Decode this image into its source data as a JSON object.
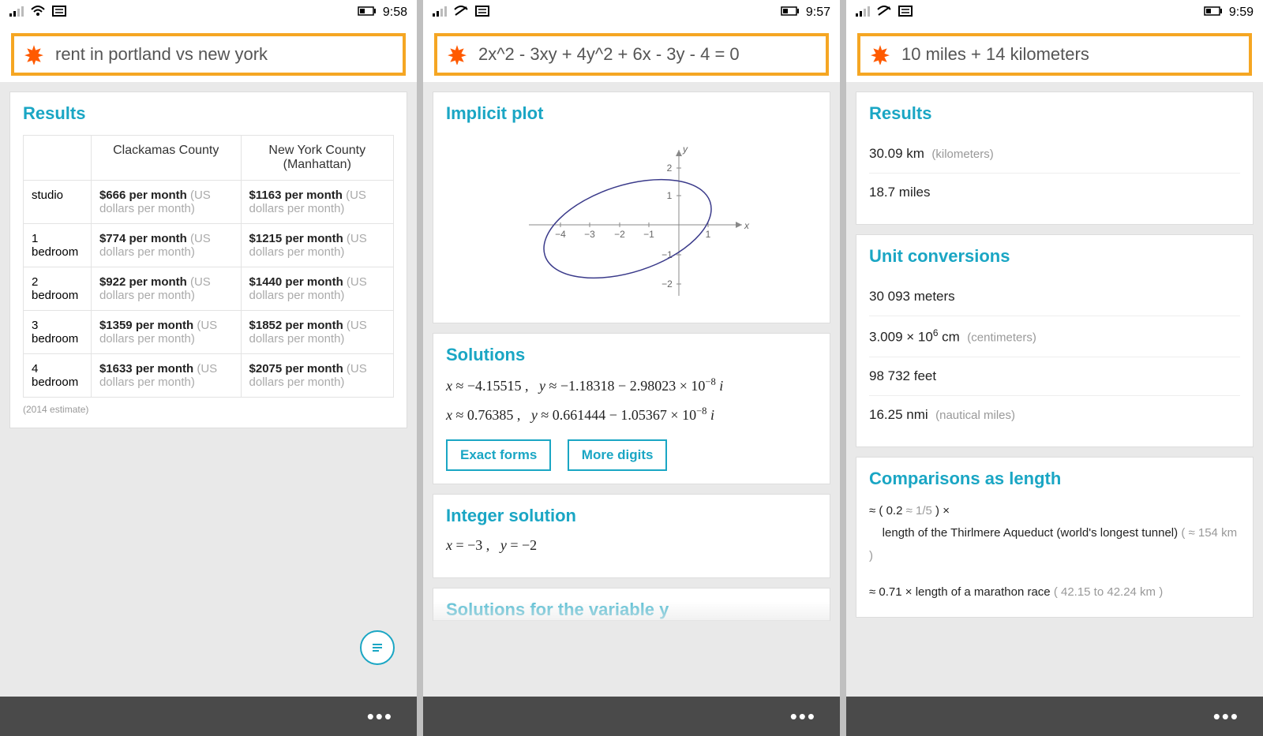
{
  "screens": [
    {
      "status_time": "9:58",
      "query": "rent in portland vs new york",
      "results_title": "Results",
      "table": {
        "headers": [
          "",
          "Clackamas County",
          "New York County (Manhattan)"
        ],
        "rows": [
          {
            "label": "studio",
            "a": "$666 per month",
            "b": "$1163 per month"
          },
          {
            "label": "1 bedroom",
            "a": "$774 per month",
            "b": "$1215 per month"
          },
          {
            "label": "2 bedroom",
            "a": "$922 per month",
            "b": "$1440 per month"
          },
          {
            "label": "3 bedroom",
            "a": "$1359 per month",
            "b": "$1852 per month"
          },
          {
            "label": "4 bedroom",
            "a": "$1633 per month",
            "b": "$2075 per month"
          }
        ],
        "cell_sub": "(US dollars per month)"
      },
      "footnote": "(2014 estimate)"
    },
    {
      "status_time": "9:57",
      "query": "2x^2 - 3xy + 4y^2 + 6x - 3y - 4 = 0",
      "implicit_title": "Implicit plot",
      "solutions_title": "Solutions",
      "sol1": "x ≈ −4.15515 ,   y ≈ −1.18318 − 2.98023 × 10⁻⁸ i",
      "sol2": "x ≈ 0.76385 ,   y ≈ 0.661444 − 1.05367 × 10⁻⁸ i",
      "btn_exact": "Exact forms",
      "btn_more": "More digits",
      "int_title": "Integer solution",
      "int_sol": "x = −3 ,   y = −2",
      "next_title": "Solutions for the variable y"
    },
    {
      "status_time": "9:59",
      "query": "10 miles + 14 kilometers",
      "results_title": "Results",
      "res1_val": "30.09 km",
      "res1_sub": "(kilometers)",
      "res2_val": "18.7 miles",
      "unit_title": "Unit conversions",
      "u1": "30 093 meters",
      "u2_val": "3.009 × 10⁶ cm",
      "u2_sub": "(centimeters)",
      "u3": "98 732 feet",
      "u4_val": "16.25 nmi",
      "u4_sub": "(nautical miles)",
      "comp_title": "Comparisons as length",
      "comp1_prefix": "≈ ( 0.2 ",
      "comp1_approx": "≈ 1/5",
      "comp1_suffix": " ) ×",
      "comp1_desc": "length of the Thirlmere Aqueduct (world's longest tunnel)",
      "comp1_paren": "( ≈ 154 km )",
      "comp2_main": "≈ 0.71 × length of a marathon race",
      "comp2_paren": "( 42.15 to 42.24 km )"
    }
  ]
}
